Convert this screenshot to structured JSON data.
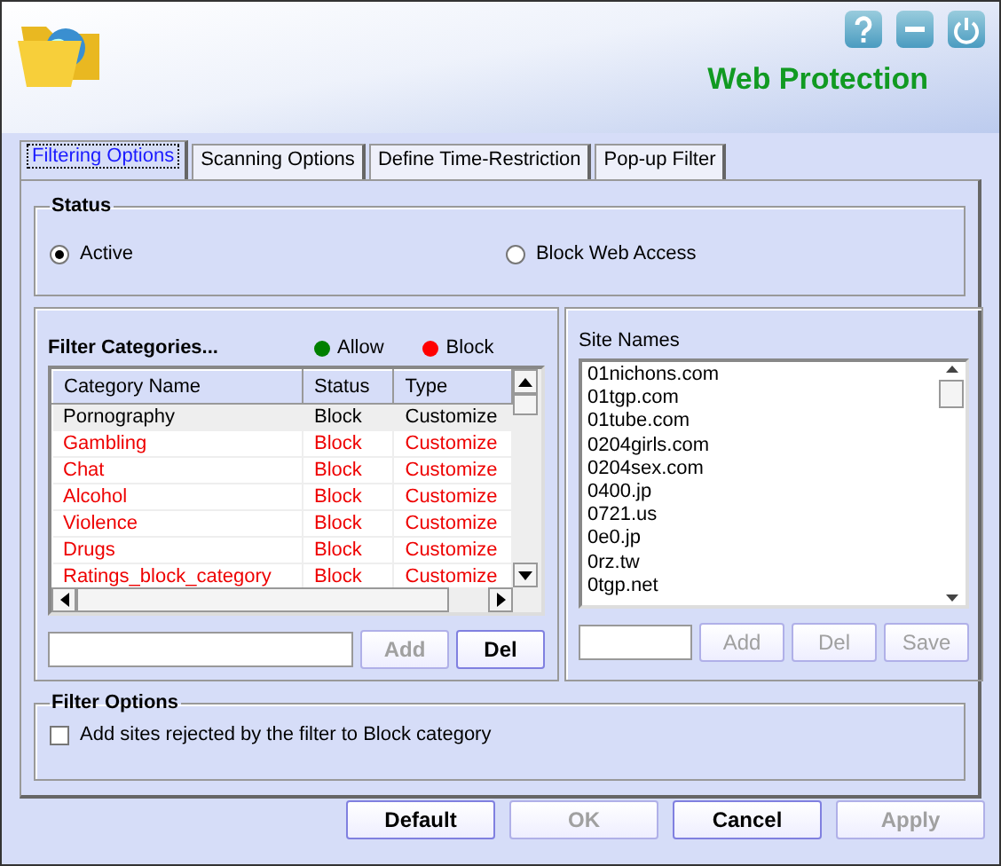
{
  "header": {
    "title": "Web Protection"
  },
  "tabs": [
    {
      "label": "Filtering Options",
      "selected": true
    },
    {
      "label": "Scanning Options",
      "selected": false
    },
    {
      "label": "Define Time-Restriction",
      "selected": false
    },
    {
      "label": "Pop-up Filter",
      "selected": false
    }
  ],
  "status": {
    "title": "Status",
    "options": [
      {
        "label": "Active",
        "selected": true
      },
      {
        "label": "Block Web Access",
        "selected": false
      }
    ]
  },
  "categories": {
    "title": "Filter Categories...",
    "legend": [
      {
        "label": "Allow",
        "color": "#008000"
      },
      {
        "label": "Block",
        "color": "#ff0000"
      }
    ],
    "columns": [
      "Category Name",
      "Status",
      "Type"
    ],
    "rows": [
      {
        "name": "Pornography",
        "status": "Block",
        "type": "Customize",
        "selected": true
      },
      {
        "name": "Gambling",
        "status": "Block",
        "type": "Customize",
        "selected": false
      },
      {
        "name": "Chat",
        "status": "Block",
        "type": "Customize",
        "selected": false
      },
      {
        "name": "Alcohol",
        "status": "Block",
        "type": "Customize",
        "selected": false
      },
      {
        "name": "Violence",
        "status": "Block",
        "type": "Customize",
        "selected": false
      },
      {
        "name": "Drugs",
        "status": "Block",
        "type": "Customize",
        "selected": false
      },
      {
        "name": "Ratings_block_category",
        "status": "Block",
        "type": "Customize",
        "selected": false
      }
    ],
    "buttons": [
      {
        "label": "Add",
        "disabled": true
      },
      {
        "label": "Del",
        "disabled": false
      }
    ]
  },
  "sites": {
    "title": "Site Names",
    "items": [
      "01nichons.com",
      "01tgp.com",
      "01tube.com",
      "0204girls.com",
      "0204sex.com",
      "0400.jp",
      "0721.us",
      "0e0.jp",
      "0rz.tw",
      "0tgp.net"
    ],
    "buttons": [
      {
        "label": "Add",
        "disabled": true
      },
      {
        "label": "Del",
        "disabled": true
      },
      {
        "label": "Save",
        "disabled": true
      }
    ]
  },
  "filter_options": {
    "title": "Filter Options",
    "checkbox": {
      "label": "Add sites rejected by the filter to Block category",
      "checked": false
    }
  },
  "buttons": [
    {
      "label": "Default",
      "disabled": false
    },
    {
      "label": "OK",
      "disabled": true
    },
    {
      "label": "Cancel",
      "disabled": false
    },
    {
      "label": "Apply",
      "disabled": true
    }
  ]
}
